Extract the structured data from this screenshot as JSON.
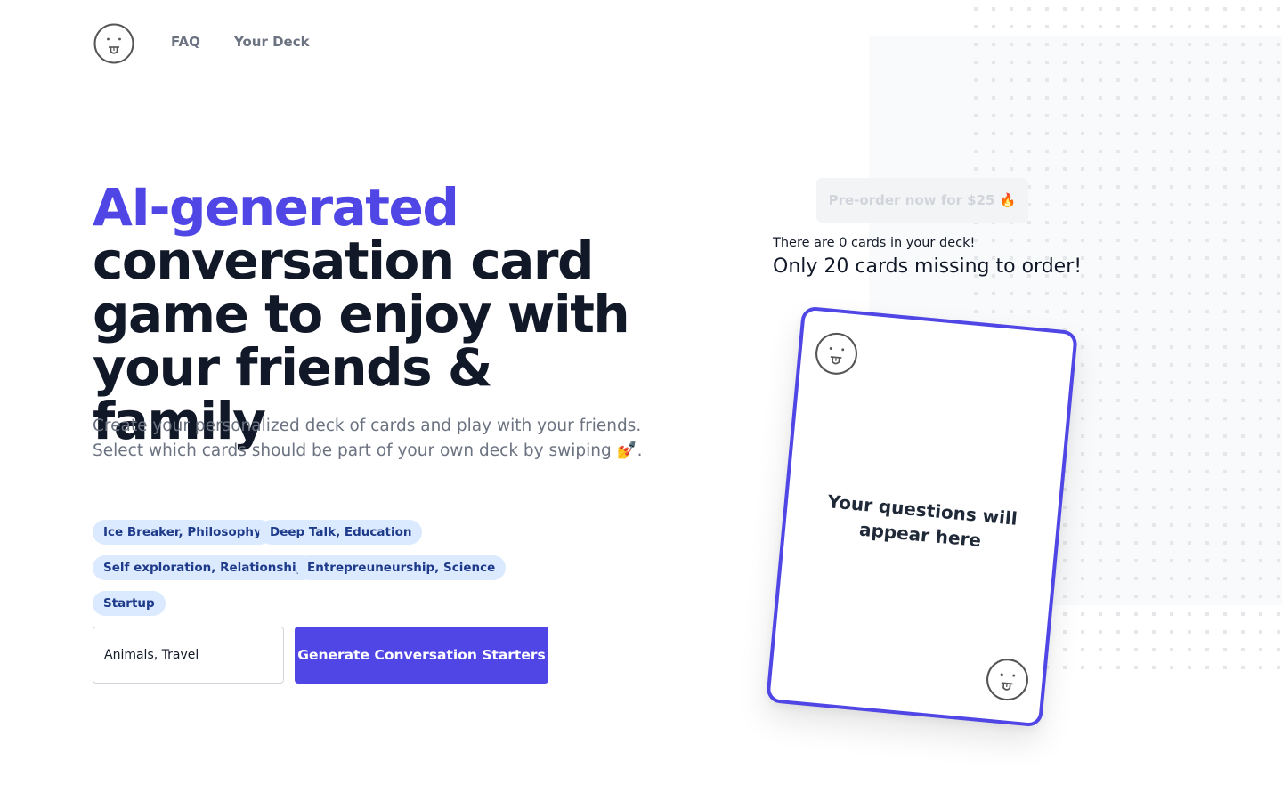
{
  "nav": {
    "logo_icon": "tongue-out-face-icon",
    "links": [
      {
        "label": "FAQ"
      },
      {
        "label": "Your Deck"
      }
    ]
  },
  "hero": {
    "title_accent": "AI-generated",
    "title_rest": "conversation card game to enjoy with your friends & family",
    "subtitle_line1": "Create your personalized deck of cards and play with your friends.",
    "subtitle_line2": "Select which cards should be part of your own deck by swiping 💅."
  },
  "tags": [
    {
      "label": "Ice Breaker, Philosophy"
    },
    {
      "label": "Deep Talk, Education"
    },
    {
      "label": "Self exploration, Relationship"
    },
    {
      "label": "Entrepreuneurship, Science"
    },
    {
      "label": "Startup"
    }
  ],
  "form": {
    "topic_value": "Animals, Travel",
    "generate_label": "Generate Conversation Starters"
  },
  "deck": {
    "preorder_label": "Pre-order now for $25 🔥",
    "count_text": "There are 0 cards in your deck!",
    "missing_text": "Only 20 cards missing to order!"
  },
  "card": {
    "placeholder_text": "Your questions will appear here",
    "corner_icon": "tongue-out-face-icon"
  },
  "colors": {
    "accent": "#4f46e5",
    "tag_bg": "#dbeafe",
    "tag_text": "#1e3a8a",
    "heading": "#111827",
    "muted": "#6b7280"
  }
}
